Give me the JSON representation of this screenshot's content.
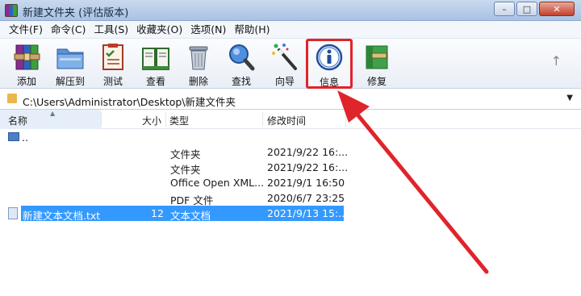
{
  "window": {
    "title": "新建文件夹 (评估版本)",
    "controls": {
      "minimize": "–",
      "maximize": "□",
      "close": "✕"
    }
  },
  "menu": [
    "文件(F)",
    "命令(C)",
    "工具(S)",
    "收藏夹(O)",
    "选项(N)",
    "帮助(H)"
  ],
  "toolbar": {
    "add": "添加",
    "extract": "解压到",
    "test": "测试",
    "view": "查看",
    "delete": "删除",
    "find": "查找",
    "wizard": "向导",
    "info": "信息",
    "repair": "修复",
    "up_arrow": "↑"
  },
  "address": {
    "path": "C:\\Users\\Administrator\\Desktop\\新建文件夹",
    "dropdown": "▼"
  },
  "columns": {
    "name": "名称",
    "size": "大小",
    "type": "类型",
    "modified": "修改时间"
  },
  "rows": [
    {
      "name": "..",
      "size": "",
      "type": "",
      "modified": ""
    },
    {
      "name": "",
      "size": "",
      "type": "文件夹",
      "modified": "2021/9/22 16:..."
    },
    {
      "name": "",
      "size": "",
      "type": "文件夹",
      "modified": "2021/9/22 16:..."
    },
    {
      "name": "",
      "size": "",
      "type": "Office Open XML...",
      "modified": "2021/9/1 16:50"
    },
    {
      "name": "",
      "size": "",
      "type": "PDF 文件",
      "modified": "2020/6/7 23:25"
    },
    {
      "name": "新建文本文档.txt",
      "size": "12",
      "type": "文本文档",
      "modified": "2021/9/13 15:..."
    }
  ],
  "colors": {
    "highlight_box": "#e0242b",
    "arrow": "#e0242b",
    "selection": "#3399ff"
  },
  "icons": {
    "add": "archive-books-icon",
    "extract": "folder-extract-icon",
    "test": "clipboard-check-icon",
    "view": "open-book-icon",
    "delete": "trash-can-icon",
    "find": "magnifier-icon",
    "wizard": "magic-wand-icon",
    "info": "info-icon",
    "repair": "green-box-repair-icon"
  }
}
